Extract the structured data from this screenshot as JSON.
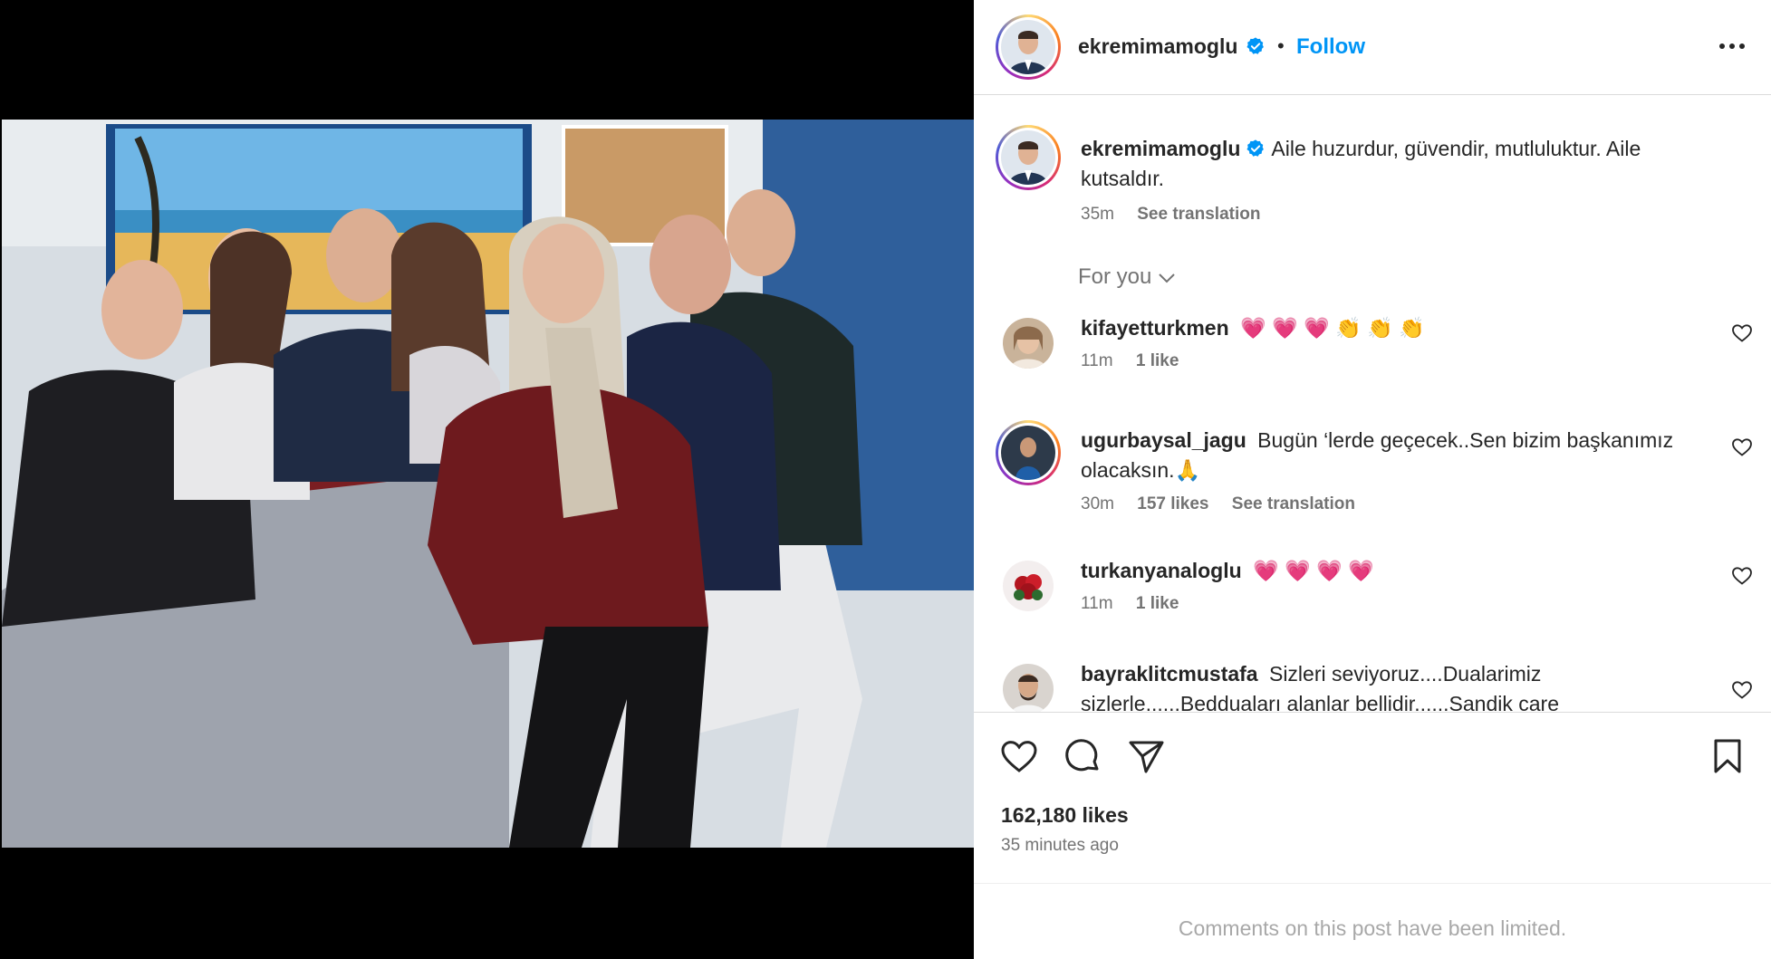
{
  "post": {
    "username": "ekremimamoglu",
    "follow_label": "Follow",
    "caption": "Aile huzurdur, güvendir, mutluluktur. Aile kutsaldır.",
    "caption_time": "35m",
    "see_translation": "See translation"
  },
  "filter": {
    "label": "For you"
  },
  "comments": [
    {
      "username": "kifayetturkmen",
      "text": "💗 💗 💗 👏 👏 👏",
      "time": "11m",
      "likes": "1 like",
      "translation": ""
    },
    {
      "username": "ugurbaysal_jagu",
      "text": "Bugün ‘lerde geçecek..Sen bizim başkanımız olacaksın.🙏",
      "time": "30m",
      "likes": "157 likes",
      "translation": "See translation"
    },
    {
      "username": "turkanyanaloglu",
      "text": "💗 💗 💗 💗",
      "time": "11m",
      "likes": "1 like",
      "translation": ""
    },
    {
      "username": "bayraklitcmustafa",
      "text": "Sizleri seviyoruz....Dualarimiz sizlerle......Bedduaları alanlar bellidir......Sandik care",
      "time": "",
      "likes": "",
      "translation": ""
    }
  ],
  "footer": {
    "likes_count": "162,180 likes",
    "posted_ago": "35 minutes ago",
    "comments_limited": "Comments on this post have been limited."
  },
  "colors": {
    "accent": "#0095f6",
    "verified": "#0095f6",
    "muted": "#737373"
  },
  "icons": [
    "verified-icon",
    "more-options-icon",
    "like-icon",
    "comment-icon",
    "share-icon",
    "save-icon",
    "chevron-down-icon"
  ]
}
